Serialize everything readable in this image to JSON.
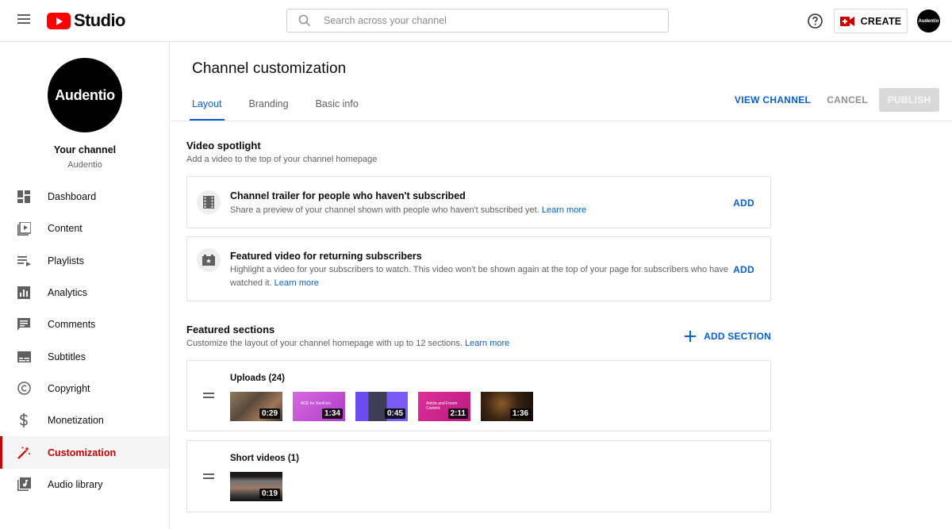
{
  "topbar": {
    "logo_text": "Studio",
    "search_placeholder": "Search across your channel",
    "create_label": "CREATE",
    "avatar_text": "Audentio"
  },
  "sidebar": {
    "avatar_text": "Audentio",
    "your_channel_label": "Your channel",
    "channel_name": "Audentio",
    "items": [
      {
        "label": "Dashboard",
        "icon": "dashboard-icon"
      },
      {
        "label": "Content",
        "icon": "content-icon"
      },
      {
        "label": "Playlists",
        "icon": "playlists-icon"
      },
      {
        "label": "Analytics",
        "icon": "analytics-icon"
      },
      {
        "label": "Comments",
        "icon": "comments-icon"
      },
      {
        "label": "Subtitles",
        "icon": "subtitles-icon"
      },
      {
        "label": "Copyright",
        "icon": "copyright-icon"
      },
      {
        "label": "Monetization",
        "icon": "dollar-icon"
      },
      {
        "label": "Customization",
        "icon": "magic-wand-icon",
        "active": true
      },
      {
        "label": "Audio library",
        "icon": "audio-library-icon"
      }
    ]
  },
  "main": {
    "title": "Channel customization",
    "tabs": [
      {
        "label": "Layout",
        "active": true
      },
      {
        "label": "Branding"
      },
      {
        "label": "Basic info"
      }
    ],
    "actions": {
      "view_channel": "VIEW CHANNEL",
      "cancel": "CANCEL",
      "publish": "PUBLISH"
    },
    "spotlight": {
      "title": "Video spotlight",
      "subtitle": "Add a video to the top of your channel homepage",
      "cards": [
        {
          "title": "Channel trailer for people who haven't subscribed",
          "desc": "Share a preview of your channel shown with people who haven't subscribed yet.",
          "link": "Learn more",
          "add": "ADD"
        },
        {
          "title": "Featured video for returning subscribers",
          "desc": "Highlight a video for your subscribers to watch. This video won't be shown again at the top of your page for subscribers who have watched it.",
          "link": "Learn more",
          "add": "ADD"
        }
      ]
    },
    "featured": {
      "title": "Featured sections",
      "subtitle": "Customize the layout of your channel homepage with up to 12 sections.",
      "link": "Learn more",
      "add_section": "ADD SECTION",
      "rows": [
        {
          "title": "Uploads (24)",
          "videos": [
            {
              "duration": "0:29",
              "color": "#6b5a4a"
            },
            {
              "duration": "1:34",
              "color": "#c94fd6",
              "caption": "ACE for XenForo"
            },
            {
              "duration": "0:45",
              "color": "#6c4cf0"
            },
            {
              "duration": "2:11",
              "color": "#d4238f",
              "caption": "Article and Forum Content"
            },
            {
              "duration": "1:36",
              "color": "#2b1c12"
            }
          ]
        },
        {
          "title": "Short videos (1)",
          "videos": [
            {
              "duration": "0:19",
              "color": "#4a4a4a"
            }
          ]
        }
      ]
    }
  },
  "colors": {
    "accent_blue": "#065fd4",
    "active_red": "#cc0000",
    "youtube_red": "#ff0000"
  }
}
